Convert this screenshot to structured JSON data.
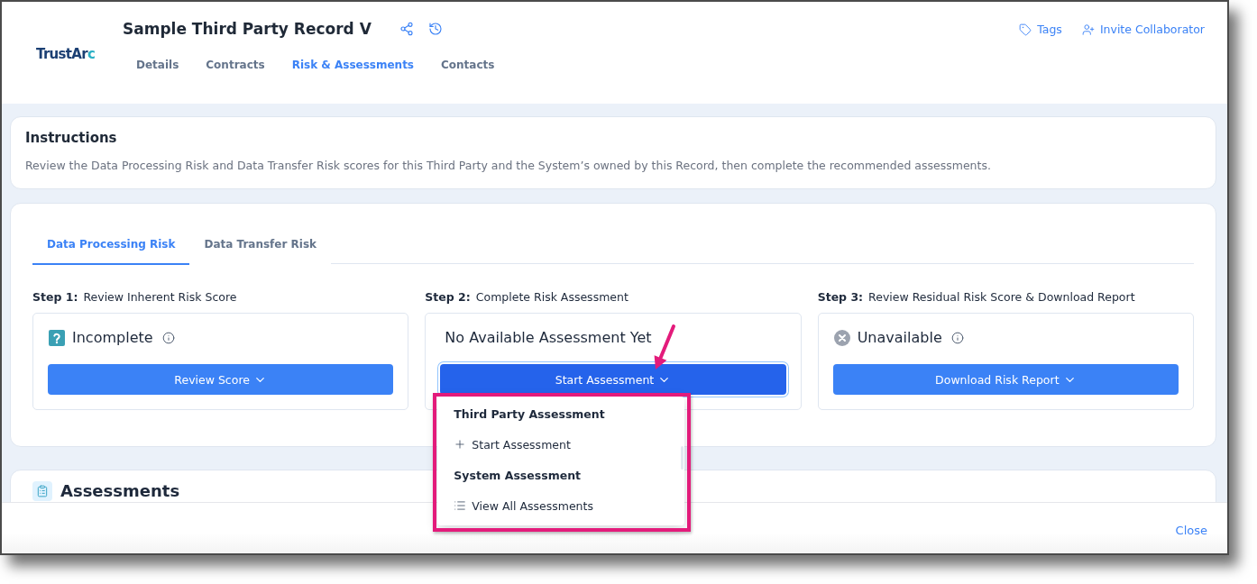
{
  "header": {
    "logo": "TrustArc",
    "title": "Sample Third Party Record V",
    "tabs": [
      {
        "label": "Details",
        "selected": false
      },
      {
        "label": "Contracts",
        "selected": false
      },
      {
        "label": "Risk & Assessments",
        "selected": true
      },
      {
        "label": "Contacts",
        "selected": false
      }
    ],
    "actions": [
      {
        "kind": "tags",
        "label": "Tags"
      },
      {
        "kind": "invite",
        "label": "Invite Collaborator"
      }
    ]
  },
  "instructions": {
    "title": "Instructions",
    "text": "Review the Data Processing Risk and Data Transfer Risk scores for this Third Party and the System’s owned by this Record, then complete the recommended assessments."
  },
  "risk_tabs": [
    {
      "label": "Data Processing Risk",
      "selected": true
    },
    {
      "label": "Data Transfer Risk",
      "selected": false
    }
  ],
  "steps": [
    {
      "label": "**Step 1:** Review Inherent Risk Score",
      "kind": "incomplete",
      "status": "Incomplete",
      "button": {
        "label": "Review Score",
        "expanded": false
      }
    },
    {
      "label": "**Step 2:** Complete Risk Assessment",
      "kind": "empty",
      "status": "No Available Assessment Yet",
      "button": {
        "label": "Start Assessment",
        "expanded": true,
        "menu": [
          {
            "kind": "heading",
            "label": "Third Party Assessment"
          },
          {
            "kind": "add",
            "label": "Start Assessment"
          },
          {
            "kind": "heading",
            "label": "System Assessment"
          },
          {
            "kind": "view",
            "label": "View All Assessments"
          }
        ]
      }
    },
    {
      "label": "**Step 3:** Review Residual Risk Score & Download Report",
      "kind": "unavailable",
      "status": "Unavailable",
      "button": {
        "label": "Download Risk Report",
        "expanded": false
      }
    }
  ],
  "assessments": {
    "title": "Assessments"
  },
  "footer": {
    "close": "Close"
  }
}
